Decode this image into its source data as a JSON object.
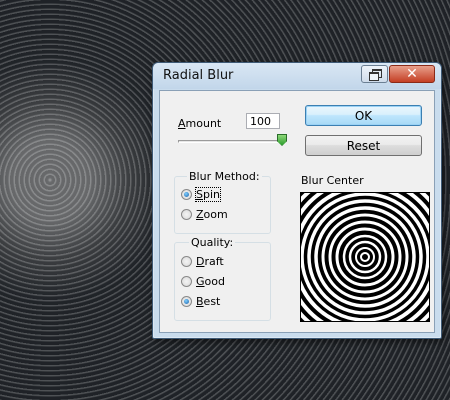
{
  "dialog": {
    "title": "Radial Blur",
    "close_glyph": "✕"
  },
  "amount": {
    "label": "Amount",
    "value": "100",
    "slider_fraction": 1.0
  },
  "buttons": {
    "ok": "OK",
    "reset": "Reset"
  },
  "blur_method": {
    "legend": "Blur Method:",
    "options": [
      {
        "label": "Spin",
        "checked": true
      },
      {
        "label": "Zoom",
        "checked": false
      }
    ]
  },
  "quality": {
    "legend": "Quality:",
    "options": [
      {
        "label": "Draft",
        "checked": false
      },
      {
        "label": "Good",
        "checked": false
      },
      {
        "label": "Best",
        "checked": true
      }
    ]
  },
  "blur_center": {
    "label": "Blur Center"
  },
  "icons": {
    "restore": "restore-icon",
    "close": "close-icon"
  },
  "colors": {
    "titlebar": "#c9dced",
    "close_button": "#c43f24",
    "ok_border": "#3c7fb1",
    "slider_thumb": "#2e9d2e"
  }
}
